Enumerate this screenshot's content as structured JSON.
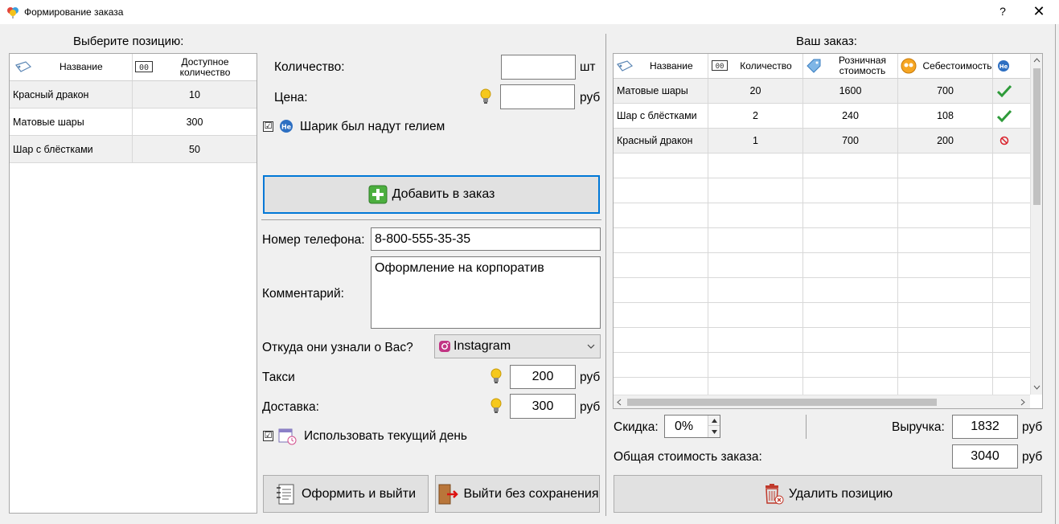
{
  "window": {
    "title": "Формирование заказа",
    "help_label": "?",
    "close_label": "✕"
  },
  "left_panel": {
    "title": "Выберите позицию:",
    "columns": [
      "Название",
      "Доступное количество"
    ],
    "rows": [
      {
        "name": "Красный дракон",
        "qty": "10"
      },
      {
        "name": "Матовые шары",
        "qty": "300"
      },
      {
        "name": "Шар с блёстками",
        "qty": "50"
      }
    ]
  },
  "middle": {
    "quantity_label": "Количество:",
    "quantity_value": "",
    "quantity_unit": "шт",
    "price_label": "Цена:",
    "price_value": "",
    "price_unit": "руб",
    "helium_checkbox": {
      "label": "Шарик был надут гелием",
      "checked": true,
      "mark": "☑"
    },
    "helium_icon_text": "He",
    "add_button": "Добавить в заказ",
    "phone_label": "Номер телефона:",
    "phone_value": "8-800-555-35-35",
    "comment_label": "Комментарий:",
    "comment_value": "Оформление на корпоратив",
    "source_label": "Откуда они узнали о Вас?",
    "source_value": "Instagram",
    "taxi_label": "Такси",
    "taxi_value": "200",
    "taxi_unit": "руб",
    "delivery_label": "Доставка:",
    "delivery_value": "300",
    "delivery_unit": "руб",
    "current_day_checkbox": {
      "label": "Использовать текущий день",
      "checked": true,
      "mark": "☑"
    },
    "checkout_button": "Оформить и выйти",
    "exit_button": "Выйти без сохранения"
  },
  "right_panel": {
    "title": "Ваш заказ:",
    "columns": [
      "Название",
      "Количество",
      "Розничная стоимость",
      "Себестоимость",
      "He"
    ],
    "rows": [
      {
        "name": "Матовые шары",
        "qty": "20",
        "retail": "1600",
        "cost": "700",
        "helium": "yes"
      },
      {
        "name": "Шар с блёстками",
        "qty": "2",
        "retail": "240",
        "cost": "108",
        "helium": "yes"
      },
      {
        "name": "Красный дракон",
        "qty": "1",
        "retail": "700",
        "cost": "200",
        "helium": "no"
      }
    ],
    "discount_label": "Скидка:",
    "discount_value": "0%",
    "revenue_label": "Выручка:",
    "revenue_value": "1832",
    "revenue_unit": "руб",
    "total_label": "Общая стоимость заказа:",
    "total_value": "3040",
    "total_unit": "руб",
    "delete_button": "Удалить позицию"
  },
  "colors": {
    "accent": "#0078d7",
    "check_green": "#2e9b3a",
    "no_red": "#d9202a"
  }
}
